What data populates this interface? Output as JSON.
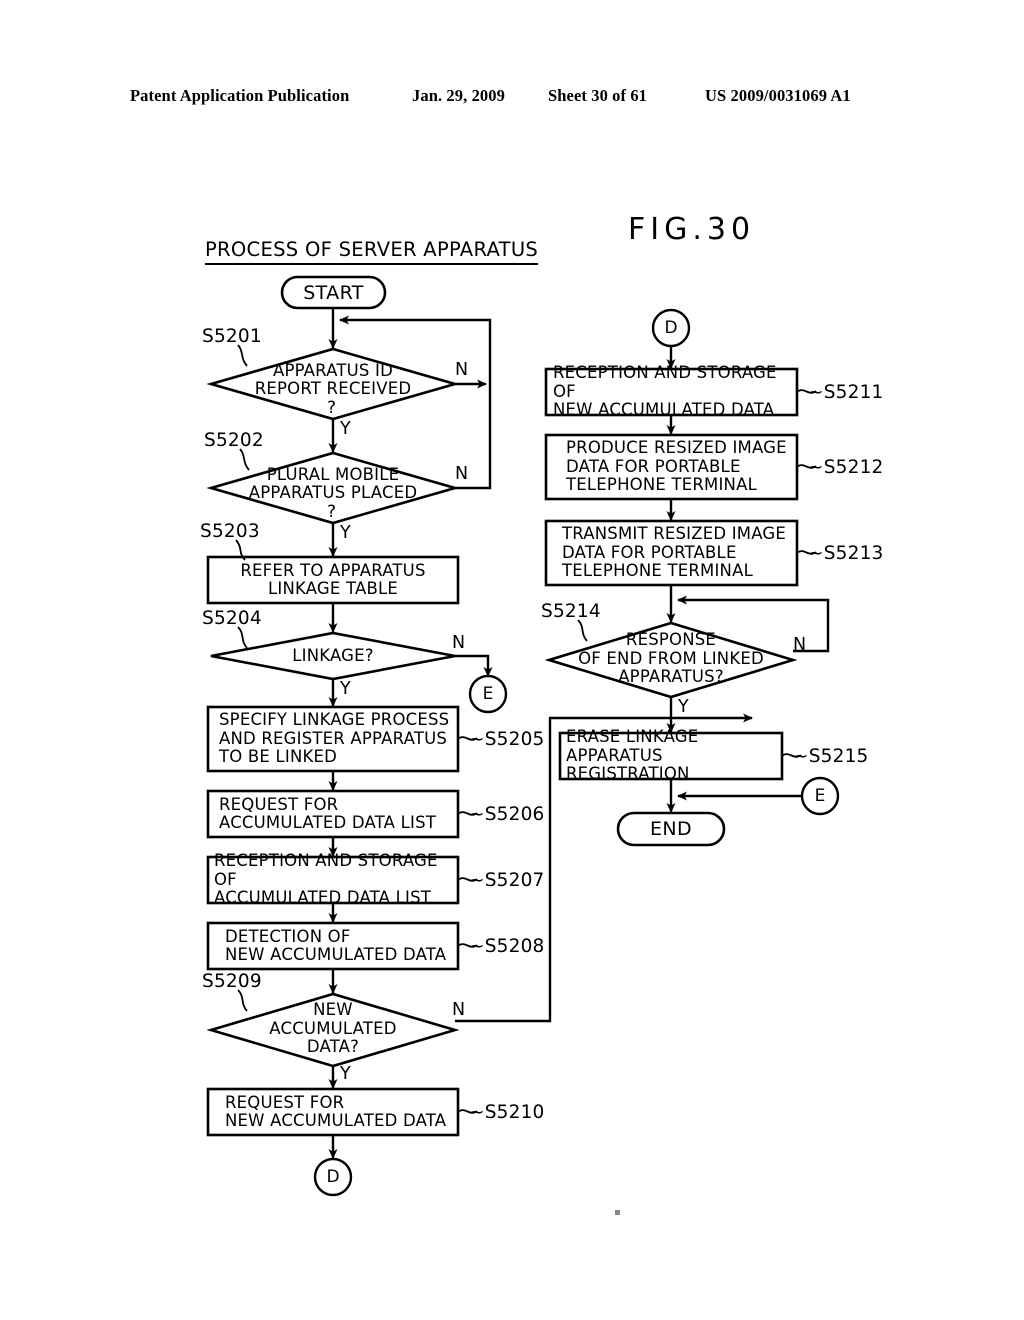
{
  "header": {
    "publication": "Patent Application Publication",
    "date": "Jan. 29, 2009",
    "sheet": "Sheet 30 of 61",
    "number": "US 2009/0031069 A1"
  },
  "figure": {
    "label": "FIG.30",
    "process_title": "PROCESS OF SERVER APPARATUS"
  },
  "chart_data": {
    "type": "diagram",
    "title": "PROCESS OF SERVER APPARATUS",
    "figure": "FIG.30",
    "terminals": [
      {
        "id": "start",
        "label": "START",
        "shape": "stadium"
      },
      {
        "id": "end",
        "label": "END",
        "shape": "stadium"
      }
    ],
    "connectors": [
      {
        "id": "conn-d-target",
        "label": "D",
        "shape": "circle",
        "role": "entry"
      },
      {
        "id": "conn-e-left",
        "label": "E",
        "shape": "circle",
        "role": "exit"
      },
      {
        "id": "conn-d-exit",
        "label": "D",
        "shape": "circle",
        "role": "exit"
      },
      {
        "id": "conn-e-right",
        "label": "E",
        "shape": "circle",
        "role": "entry"
      }
    ],
    "nodes": [
      {
        "step": "S5201",
        "shape": "decision",
        "text": "APPARATUS ID\nREPORT RECEIVED",
        "question": "?",
        "yes": "Y",
        "no": "N"
      },
      {
        "step": "S5202",
        "shape": "decision",
        "text": "PLURAL MOBILE\nAPPARATUS PLACED",
        "question": "?",
        "yes": "Y",
        "no": "N"
      },
      {
        "step": "S5203",
        "shape": "process",
        "text": "REFER TO APPARATUS\nLINKAGE TABLE"
      },
      {
        "step": "S5204",
        "shape": "decision",
        "text": "LINKAGE?",
        "yes": "Y",
        "no": "N"
      },
      {
        "step": "S5205",
        "shape": "process",
        "text": "SPECIFY LINKAGE PROCESS\nAND REGISTER APPARATUS\nTO BE LINKED"
      },
      {
        "step": "S5206",
        "shape": "process",
        "text": "REQUEST FOR\nACCUMULATED DATA LIST"
      },
      {
        "step": "S5207",
        "shape": "process",
        "text": "RECEPTION AND STORAGE OF\nACCUMULATED DATA LIST"
      },
      {
        "step": "S5208",
        "shape": "process",
        "text": "DETECTION OF\nNEW ACCUMULATED DATA"
      },
      {
        "step": "S5209",
        "shape": "decision",
        "text": "NEW\nACCUMULATED\nDATA?",
        "yes": "Y",
        "no": "N"
      },
      {
        "step": "S5210",
        "shape": "process",
        "text": "REQUEST FOR\nNEW ACCUMULATED DATA"
      },
      {
        "step": "S5211",
        "shape": "process",
        "text": "RECEPTION AND STORAGE OF\nNEW ACCUMULATED DATA"
      },
      {
        "step": "S5212",
        "shape": "process",
        "text": "PRODUCE RESIZED IMAGE\nDATA FOR PORTABLE\nTELEPHONE TERMINAL"
      },
      {
        "step": "S5213",
        "shape": "process",
        "text": "TRANSMIT RESIZED IMAGE\nDATA FOR PORTABLE\nTELEPHONE TERMINAL"
      },
      {
        "step": "S5214",
        "shape": "decision",
        "text": "RESPONSE\nOF END FROM LINKED\nAPPARATUS?",
        "yes": "Y",
        "no": "N"
      },
      {
        "step": "S5215",
        "shape": "process",
        "text": "ERASE LINKAGE\nAPPARATUS REGISTRATION"
      }
    ],
    "edges": [
      {
        "from": "start",
        "to": "S5201"
      },
      {
        "from": "S5201",
        "to": "S5202",
        "label": "Y"
      },
      {
        "from": "S5201",
        "to": "start",
        "label": "N"
      },
      {
        "from": "S5202",
        "to": "S5203",
        "label": "Y"
      },
      {
        "from": "S5202",
        "to": "start",
        "label": "N"
      },
      {
        "from": "S5203",
        "to": "S5204"
      },
      {
        "from": "S5204",
        "to": "S5205",
        "label": "Y"
      },
      {
        "from": "S5204",
        "to": "conn-e-left",
        "label": "N"
      },
      {
        "from": "S5205",
        "to": "S5206"
      },
      {
        "from": "S5206",
        "to": "S5207"
      },
      {
        "from": "S5207",
        "to": "S5208"
      },
      {
        "from": "S5208",
        "to": "S5209"
      },
      {
        "from": "S5209",
        "to": "S5210",
        "label": "Y"
      },
      {
        "from": "S5209",
        "to": "S5215",
        "label": "N"
      },
      {
        "from": "S5210",
        "to": "conn-d-exit"
      },
      {
        "from": "conn-d-target",
        "to": "S5211"
      },
      {
        "from": "S5211",
        "to": "S5212"
      },
      {
        "from": "S5212",
        "to": "S5213"
      },
      {
        "from": "S5213",
        "to": "S5214"
      },
      {
        "from": "S5214",
        "to": "S5215",
        "label": "Y"
      },
      {
        "from": "S5214",
        "to": "S5214",
        "label": "N"
      },
      {
        "from": "conn-e-right",
        "to": "end"
      },
      {
        "from": "S5215",
        "to": "end"
      }
    ]
  },
  "labels": {
    "step_S5201": "S5201",
    "step_S5202": "S5202",
    "step_S5203": "S5203",
    "step_S5204": "S5204",
    "step_S5205": "S5205",
    "step_S5206": "S5206",
    "step_S5207": "S5207",
    "step_S5208": "S5208",
    "step_S5209": "S5209",
    "step_S5210": "S5210",
    "step_S5211": "S5211",
    "step_S5212": "S5212",
    "step_S5213": "S5213",
    "step_S5214": "S5214",
    "step_S5215": "S5215",
    "ref_S5205": "~S5205",
    "ref_S5206": "~S5206",
    "ref_S5207": "~S5207",
    "ref_S5208": "~S5208",
    "ref_S5210": "~S5210",
    "ref_S5211": "~S5211",
    "ref_S5212": "~S5212",
    "ref_S5213": "~S5213",
    "ref_S5215": "~S5215",
    "yes": "Y",
    "no": "N",
    "question": "?"
  },
  "nodes_text": {
    "start": "START",
    "end": "END",
    "d1": "D",
    "d2": "D",
    "e1": "E",
    "e2": "E",
    "s5201": "APPARATUS ID\nREPORT RECEIVED",
    "s5202": "PLURAL MOBILE\nAPPARATUS PLACED",
    "s5203": "REFER TO APPARATUS\nLINKAGE TABLE",
    "s5204": "LINKAGE?",
    "s5205": "SPECIFY LINKAGE PROCESS\nAND REGISTER APPARATUS\nTO BE LINKED",
    "s5206": "REQUEST FOR\nACCUMULATED DATA LIST",
    "s5207": "RECEPTION AND STORAGE OF\nACCUMULATED DATA LIST",
    "s5208": "DETECTION OF\nNEW ACCUMULATED DATA",
    "s5209": "NEW\nACCUMULATED\nDATA?",
    "s5210": "REQUEST FOR\nNEW ACCUMULATED DATA",
    "s5211": "RECEPTION AND STORAGE OF\nNEW ACCUMULATED DATA",
    "s5212": "PRODUCE RESIZED IMAGE\nDATA FOR PORTABLE\nTELEPHONE TERMINAL",
    "s5213": "TRANSMIT RESIZED IMAGE\nDATA FOR PORTABLE\nTELEPHONE TERMINAL",
    "s5214": "RESPONSE\nOF END FROM LINKED\nAPPARATUS?",
    "s5215": "ERASE LINKAGE\nAPPARATUS REGISTRATION"
  },
  "colors": {
    "ink": "#000000",
    "paper": "#ffffff"
  }
}
